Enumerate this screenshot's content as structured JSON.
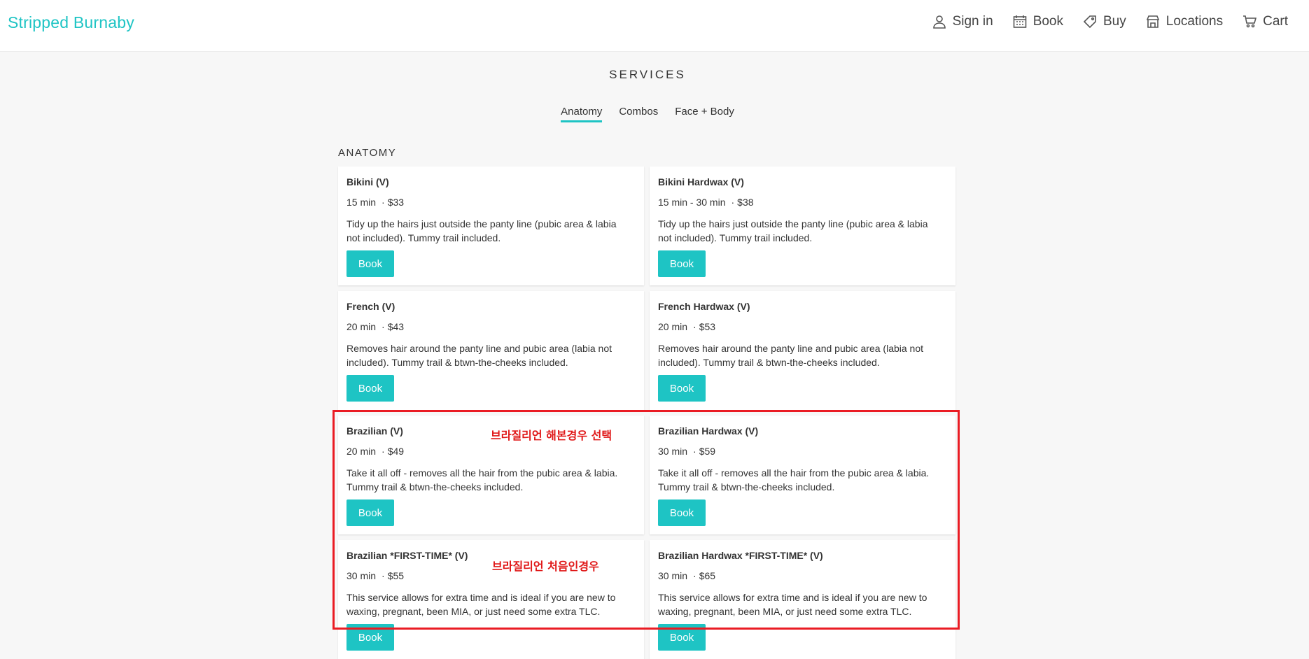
{
  "header": {
    "brand": "Stripped Burnaby",
    "nav": [
      {
        "label": "Sign in",
        "icon": "user-icon"
      },
      {
        "label": "Book",
        "icon": "calendar-icon"
      },
      {
        "label": "Buy",
        "icon": "tag-icon"
      },
      {
        "label": "Locations",
        "icon": "store-icon"
      },
      {
        "label": "Cart",
        "icon": "cart-icon"
      }
    ]
  },
  "page": {
    "title": "SERVICES",
    "tabs": [
      {
        "label": "Anatomy",
        "active": true
      },
      {
        "label": "Combos",
        "active": false
      },
      {
        "label": "Face + Body",
        "active": false
      }
    ],
    "section_title": "ANATOMY"
  },
  "services": [
    {
      "name": "Bikini (V)",
      "duration": "15 min",
      "price": "$33",
      "description": "Tidy up the hairs just outside the panty line (pubic area & labia not included). Tummy trail included.",
      "button": "Book"
    },
    {
      "name": "Bikini Hardwax (V)",
      "duration": "15 min - 30 min",
      "price": "$38",
      "description": "Tidy up the hairs just outside the panty line (pubic area & labia not included). Tummy trail included.",
      "button": "Book"
    },
    {
      "name": "French (V)",
      "duration": "20 min",
      "price": "$43",
      "description": "Removes hair around the panty line and pubic area (labia not included). Tummy trail & btwn-the-cheeks included.",
      "button": "Book"
    },
    {
      "name": "French Hardwax (V)",
      "duration": "20 min",
      "price": "$53",
      "description": "Removes hair around the panty line and pubic area (labia not included). Tummy trail & btwn-the-cheeks included.",
      "button": "Book"
    },
    {
      "name": "Brazilian (V)",
      "duration": "20 min",
      "price": "$49",
      "description": "Take it all off - removes all the hair from the pubic area & labia. Tummy trail & btwn-the-cheeks included.",
      "button": "Book"
    },
    {
      "name": "Brazilian Hardwax (V)",
      "duration": "30 min",
      "price": "$59",
      "description": "Take it all off - removes all the hair from the pubic area & labia. Tummy trail & btwn-the-cheeks included.",
      "button": "Book"
    },
    {
      "name": "Brazilian *FIRST-TIME* (V)",
      "duration": "30 min",
      "price": "$55",
      "description": "This service allows for extra time and is ideal if you are new to waxing, pregnant, been MIA, or just need some extra TLC.",
      "button": "Book"
    },
    {
      "name": "Brazilian Hardwax *FIRST-TIME* (V)",
      "duration": "30 min",
      "price": "$65",
      "description": "This service allows for extra time and is ideal if you are new to waxing, pregnant, been MIA, or just need some extra TLC.",
      "button": "Book"
    }
  ],
  "annotations": {
    "note1": "브라질리언 해본경우 선택",
    "note2": "브라질리언 처음인경우",
    "color": "#ea1c24"
  },
  "colors": {
    "accent": "#1ec4c4"
  }
}
